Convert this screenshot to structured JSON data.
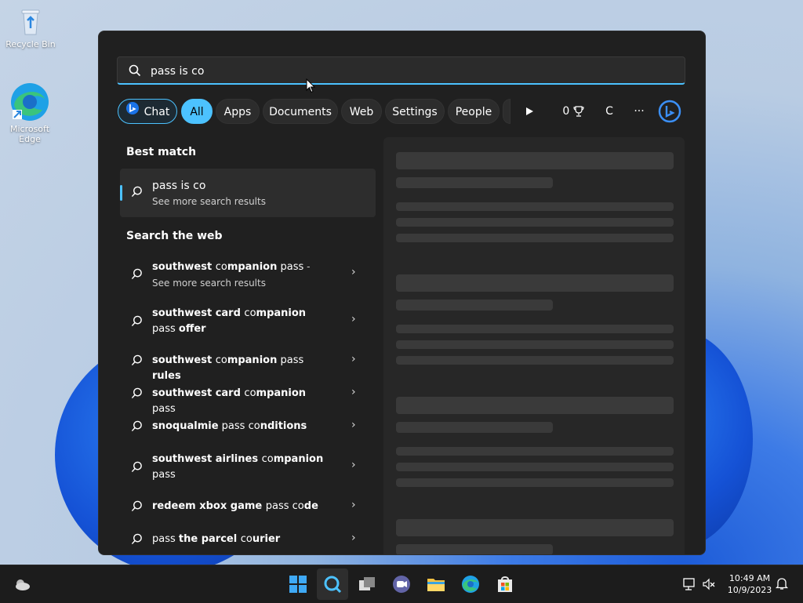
{
  "desktop": {
    "icons": [
      {
        "label": "Recycle Bin"
      },
      {
        "label": "Microsoft Edge"
      }
    ]
  },
  "search": {
    "query": "pass is co"
  },
  "filters": {
    "chat_label": "Chat",
    "chips": [
      "All",
      "Apps",
      "Documents",
      "Web",
      "Settings",
      "People"
    ],
    "active": "All",
    "rewards_count": "0",
    "user_initial": "C",
    "more": "···"
  },
  "best_match": {
    "heading": "Best match",
    "title": "pass is co",
    "subtitle": "See more search results"
  },
  "web": {
    "heading": "Search the web",
    "items": [
      {
        "parts": [
          {
            "t": "southwest ",
            "b": true
          },
          {
            "t": "co",
            "b": false
          },
          {
            "t": "mpanion",
            "b": true
          },
          {
            "t": " pass",
            "b": false
          },
          {
            "t": " - See more search results",
            "b": false,
            "sub": true
          }
        ]
      },
      {
        "parts": [
          {
            "t": "southwest card ",
            "b": true
          },
          {
            "t": "co",
            "b": false
          },
          {
            "t": "mpanion",
            "b": true
          },
          {
            "t": " pass ",
            "b": false
          },
          {
            "t": "offer",
            "b": true
          }
        ]
      },
      {
        "parts": [
          {
            "t": "southwest ",
            "b": true
          },
          {
            "t": "co",
            "b": false
          },
          {
            "t": "mpanion",
            "b": true
          },
          {
            "t": " pass ",
            "b": false
          },
          {
            "t": "rules",
            "b": true
          }
        ]
      },
      {
        "parts": [
          {
            "t": "southwest card ",
            "b": true
          },
          {
            "t": "co",
            "b": false
          },
          {
            "t": "mpanion",
            "b": true
          },
          {
            "t": " pass",
            "b": false
          }
        ]
      },
      {
        "parts": [
          {
            "t": "snoqualmie",
            "b": true
          },
          {
            "t": " pass ",
            "b": false
          },
          {
            "t": "co",
            "b": false
          },
          {
            "t": "nditions",
            "b": true
          }
        ]
      },
      {
        "parts": [
          {
            "t": "southwest airlines ",
            "b": true
          },
          {
            "t": "co",
            "b": false
          },
          {
            "t": "mpanion",
            "b": true
          },
          {
            "t": " pass",
            "b": false
          }
        ]
      },
      {
        "parts": [
          {
            "t": "redeem xbox game ",
            "b": true
          },
          {
            "t": "pass ",
            "b": false
          },
          {
            "t": "co",
            "b": false
          },
          {
            "t": "de",
            "b": true
          }
        ]
      },
      {
        "parts": [
          {
            "t": "pass ",
            "b": false
          },
          {
            "t": "the parcel ",
            "b": true
          },
          {
            "t": "co",
            "b": false
          },
          {
            "t": "urier",
            "b": true
          }
        ]
      }
    ]
  },
  "taskbar": {
    "apps": [
      "start",
      "search",
      "task-view",
      "teams-chat",
      "file-explorer",
      "edge",
      "microsoft-store"
    ],
    "time": "10:49 AM",
    "date": "10/9/2023"
  },
  "colors": {
    "accent": "#4cc2ff",
    "panel": "#202020"
  }
}
